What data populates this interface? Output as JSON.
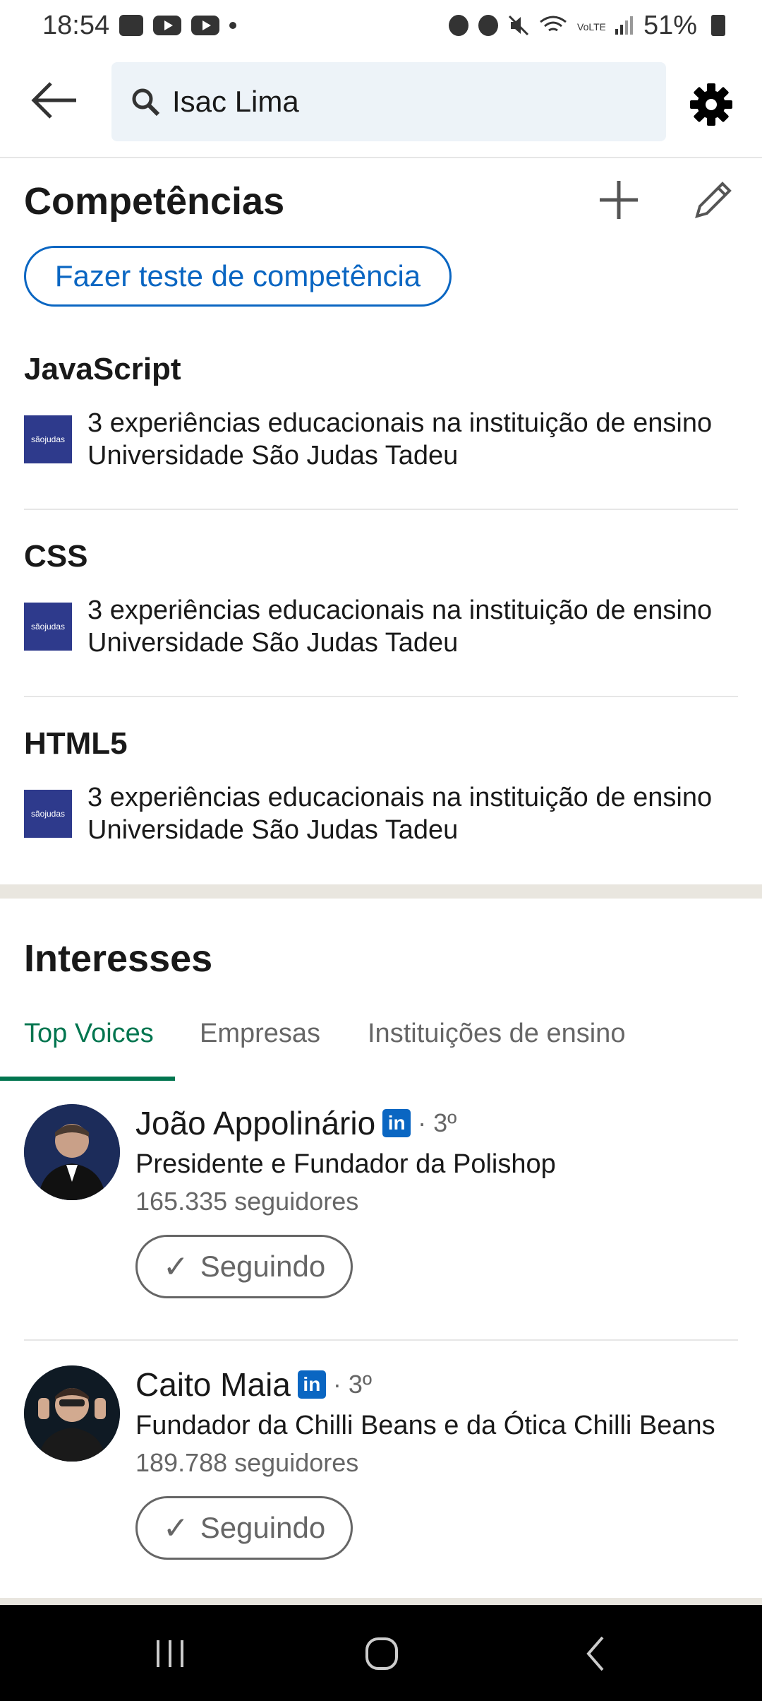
{
  "status_bar": {
    "time": "18:54",
    "battery": "51%"
  },
  "top_bar": {
    "search_value": "Isac Lima"
  },
  "skills_section": {
    "title": "Competências",
    "test_button": "Fazer teste de competência",
    "skills": [
      {
        "name": "JavaScript",
        "line1": "3 experiências educacionais na instituição de ensino",
        "line2": "Universidade São Judas Tadeu"
      },
      {
        "name": "CSS",
        "line1": "3 experiências educacionais na instituição de ensino",
        "line2": "Universidade São Judas Tadeu"
      },
      {
        "name": "HTML5",
        "line1": "3 experiências educacionais na instituição de ensino",
        "line2": "Universidade São Judas Tadeu"
      }
    ],
    "logo_text": "sãojudas"
  },
  "interests_section": {
    "title": "Interesses",
    "tabs": [
      "Top Voices",
      "Empresas",
      "Instituições de ensino"
    ],
    "voices": [
      {
        "name": "João Appolinário",
        "degree": "· 3º",
        "title": "Presidente e Fundador da Polishop",
        "followers": "165.335 seguidores",
        "button": "Seguindo"
      },
      {
        "name": "Caito Maia",
        "degree": "· 3º",
        "title": "Fundador da Chilli Beans e da Ótica Chilli Beans",
        "followers": "189.788 seguidores",
        "button": "Seguindo"
      }
    ],
    "badge_text": "in"
  },
  "colors": {
    "accent_blue": "#0a66c2",
    "tab_green": "#01754f"
  }
}
